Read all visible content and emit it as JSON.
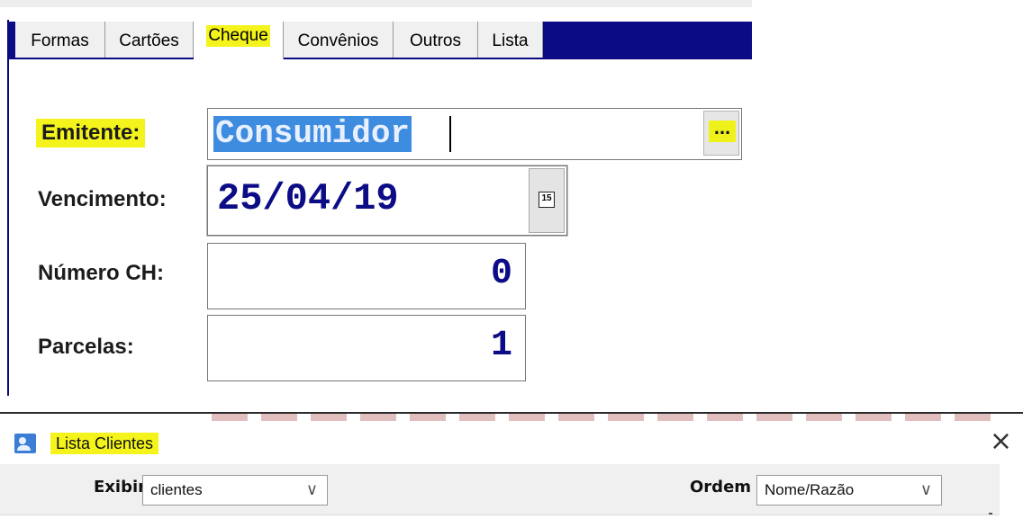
{
  "tabs": [
    {
      "label": "Formas"
    },
    {
      "label": "Cartões"
    },
    {
      "label": "Cheque"
    },
    {
      "label": "Convênios"
    },
    {
      "label": "Outros"
    },
    {
      "label": "Lista"
    }
  ],
  "active_tab": "Cheque",
  "form": {
    "emitente_label": "Emitente:",
    "emitente_value": "Consumidor",
    "browse_label": "...",
    "vencimento_label": "Vencimento:",
    "vencimento_value": "25/04/19",
    "calendar_icon_text": "15",
    "numero_label": "Número CH:",
    "numero_value": "0",
    "parcelas_label": "Parcelas:",
    "parcelas_value": "1"
  },
  "window": {
    "title": "Lista Clientes",
    "close_symbol": "×",
    "exibir_label": "Exibir",
    "exibir_value": "clientes",
    "ordem_label": "Ordem",
    "ordem_value": "Nome/Razão",
    "chevron": "∨"
  },
  "colors": {
    "highlight": "#f4f41c",
    "tab_strip": "#0b0b85",
    "value_blue": "#0c0c86",
    "selection": "#3d8ce0"
  },
  "icons": {
    "calendar": "calendar-icon",
    "app": "user-list-icon",
    "close": "close-icon",
    "dropdown": "chevron-down-icon"
  }
}
